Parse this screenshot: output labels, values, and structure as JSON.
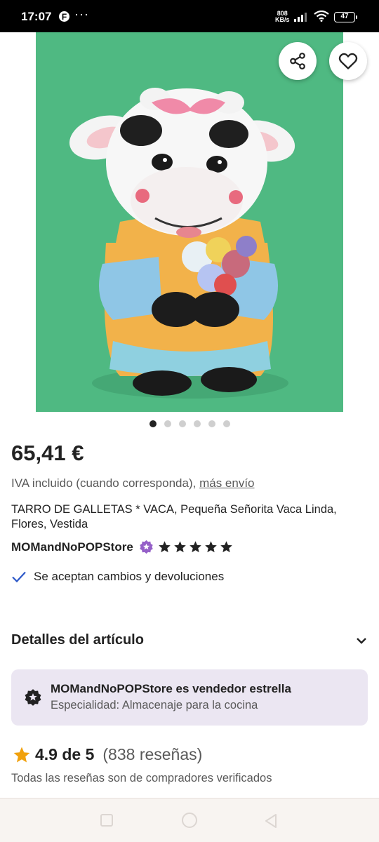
{
  "status_bar": {
    "time": "17:07",
    "notif_icon": "F",
    "more": "···",
    "speed_value": "808",
    "speed_unit": "KB/s",
    "battery": "47"
  },
  "product": {
    "image_alt": "cow-cookie-jar-photo",
    "carousel": {
      "count": 6,
      "active": 0
    },
    "price": "65,41 €",
    "vat_text": "IVA incluido (cuando corresponda), ",
    "shipping_link": "más envío",
    "title": "TARRO DE GALLETAS * VACA, Pequeña Señorita Vaca Linda, Flores, Vestida",
    "shop_name": "MOMandNoPOPStore",
    "shop_stars": 5,
    "returns_text": "Se aceptan cambios y devoluciones"
  },
  "details": {
    "title": "Detalles del artículo"
  },
  "seller_box": {
    "title": "MOMandNoPOPStore es vendedor estrella",
    "subtitle": "Especialidad: Almacenaje para la cocina"
  },
  "reviews": {
    "rating": "4.9 de 5",
    "count": "(838 reseñas)",
    "verified": "Todas las reseñas son de compradores verificados"
  },
  "colors": {
    "photo_bg": "#4fb982",
    "seller_box_bg": "#ebe6f2",
    "badge_purple": "#9560c8",
    "rating_star": "#f1a10d",
    "check_blue": "#2c58c8"
  },
  "icons": [
    "share-icon",
    "heart-icon",
    "star-seller-icon",
    "check-icon",
    "chevron-down-icon",
    "star-icon"
  ]
}
